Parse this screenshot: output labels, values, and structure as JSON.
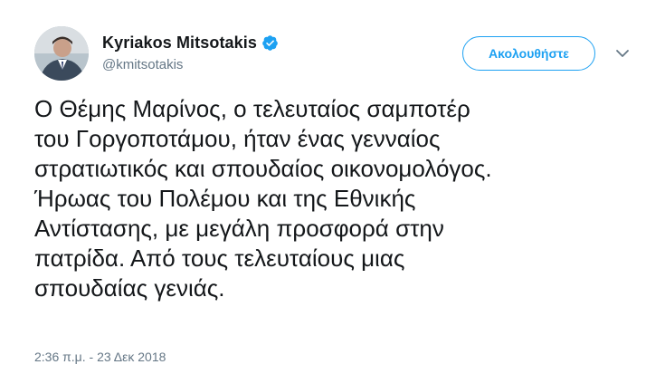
{
  "author": {
    "display_name": "Kyriakos Mitsotakis",
    "handle": "@kmitsotakis",
    "verified_icon": "verified-badge-icon",
    "avatar_icon": "profile-photo"
  },
  "actions": {
    "follow_label": "Ακολουθήστε",
    "more_icon": "chevron-down-icon"
  },
  "tweet": {
    "lines": [
      "Ο Θέμης Μαρίνος, ο τελευταίος σαμποτέρ",
      "του Γοργοποτάμου, ήταν ένας γενναίος",
      "στρατιωτικός και σπουδαίος οικονομολόγος.",
      "Ήρωας του Πολέμου και της Εθνικής",
      "Αντίστασης, με μεγάλη προσφορά στην",
      "πατρίδα. Από τους τελευταίους μιας",
      "σπουδαίας γενιάς."
    ],
    "timestamp": "2:36 π.μ. - 23 Δεκ 2018"
  },
  "colors": {
    "accent": "#1da1f2",
    "text": "#14171a",
    "secondary": "#657786"
  }
}
